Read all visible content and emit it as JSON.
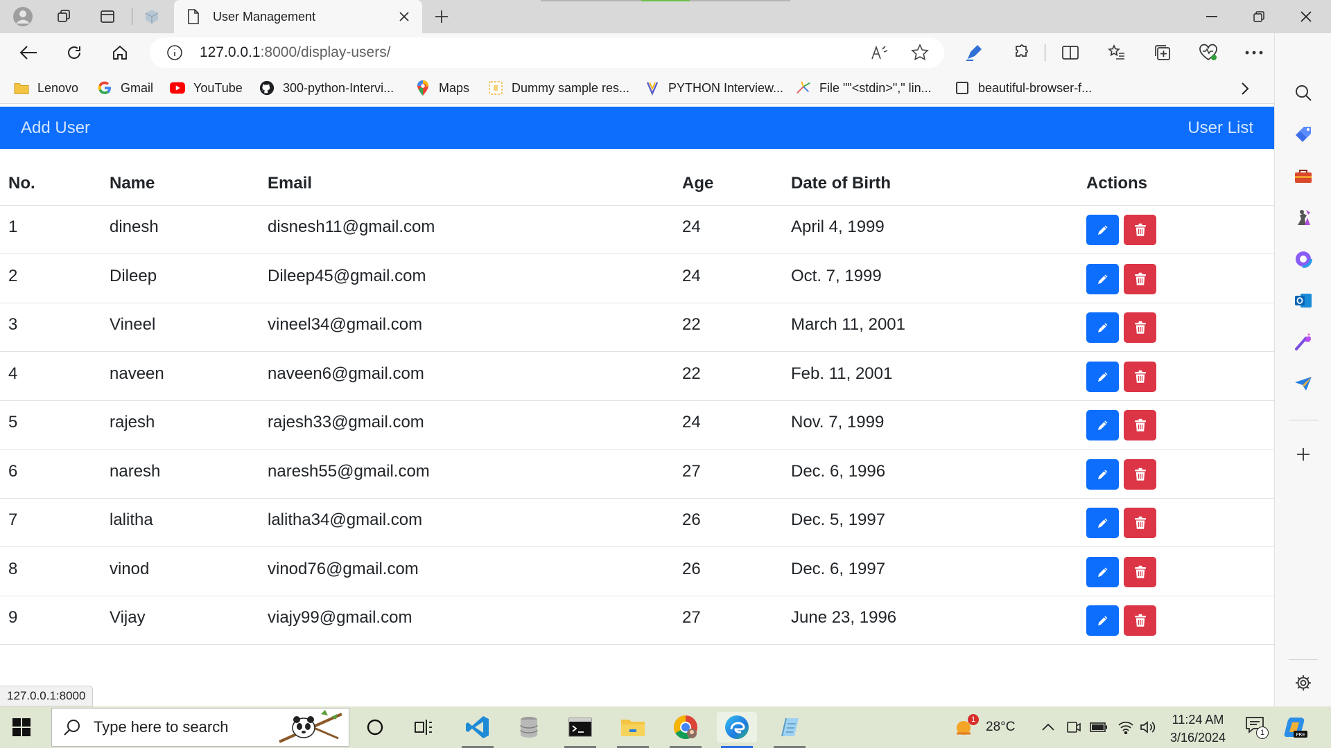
{
  "browser": {
    "tab_title": "User Management",
    "url_host": "127.0.0.1",
    "url_rest": ":8000/display-users/"
  },
  "bookmarks": [
    {
      "label": "Lenovo",
      "icon": "folder-icon"
    },
    {
      "label": "Gmail",
      "icon": "google-icon"
    },
    {
      "label": "YouTube",
      "icon": "youtube-icon"
    },
    {
      "label": "300-python-Intervi...",
      "icon": "github-icon"
    },
    {
      "label": "Maps",
      "icon": "maps-pin-icon"
    },
    {
      "label": "Dummy sample res...",
      "icon": "document-icon"
    },
    {
      "label": "PYTHON Interview...",
      "icon": "python-icon"
    },
    {
      "label": "File \"\"<stdin>\",\" lin...",
      "icon": "sparkle-icon"
    },
    {
      "label": "beautiful-browser-f...",
      "icon": "page-icon"
    }
  ],
  "app_nav": {
    "add_user": "Add User",
    "user_list": "User List"
  },
  "table": {
    "headers": [
      "No.",
      "Name",
      "Email",
      "Age",
      "Date of Birth",
      "Actions"
    ],
    "rows": [
      {
        "no": "1",
        "name": "dinesh",
        "email": "disnesh11@gmail.com",
        "age": "24",
        "dob": "April 4, 1999"
      },
      {
        "no": "2",
        "name": "Dileep",
        "email": "Dileep45@gmail.com",
        "age": "24",
        "dob": "Oct. 7, 1999"
      },
      {
        "no": "3",
        "name": "Vineel",
        "email": "vineel34@gmail.com",
        "age": "22",
        "dob": "March 11, 2001"
      },
      {
        "no": "4",
        "name": "naveen",
        "email": "naveen6@gmail.com",
        "age": "22",
        "dob": "Feb. 11, 2001"
      },
      {
        "no": "5",
        "name": "rajesh",
        "email": "rajesh33@gmail.com",
        "age": "24",
        "dob": "Nov. 7, 1999"
      },
      {
        "no": "6",
        "name": "naresh",
        "email": "naresh55@gmail.com",
        "age": "27",
        "dob": "Dec. 6, 1996"
      },
      {
        "no": "7",
        "name": "lalitha",
        "email": "lalitha34@gmail.com",
        "age": "26",
        "dob": "Dec. 5, 1997"
      },
      {
        "no": "8",
        "name": "vinod",
        "email": "vinod76@gmail.com",
        "age": "26",
        "dob": "Dec. 6, 1997"
      },
      {
        "no": "9",
        "name": "Vijay",
        "email": "viajy99@gmail.com",
        "age": "27",
        "dob": "June 23, 1996"
      }
    ]
  },
  "status_url": "127.0.0.1:8000",
  "taskbar": {
    "search_placeholder": "Type here to search",
    "weather": "28°C",
    "weather_badge": "1",
    "time": "11:24 AM",
    "date": "3/16/2024",
    "notification_count": "1"
  },
  "colors": {
    "primary": "#0d6efd",
    "danger": "#dc3545"
  }
}
